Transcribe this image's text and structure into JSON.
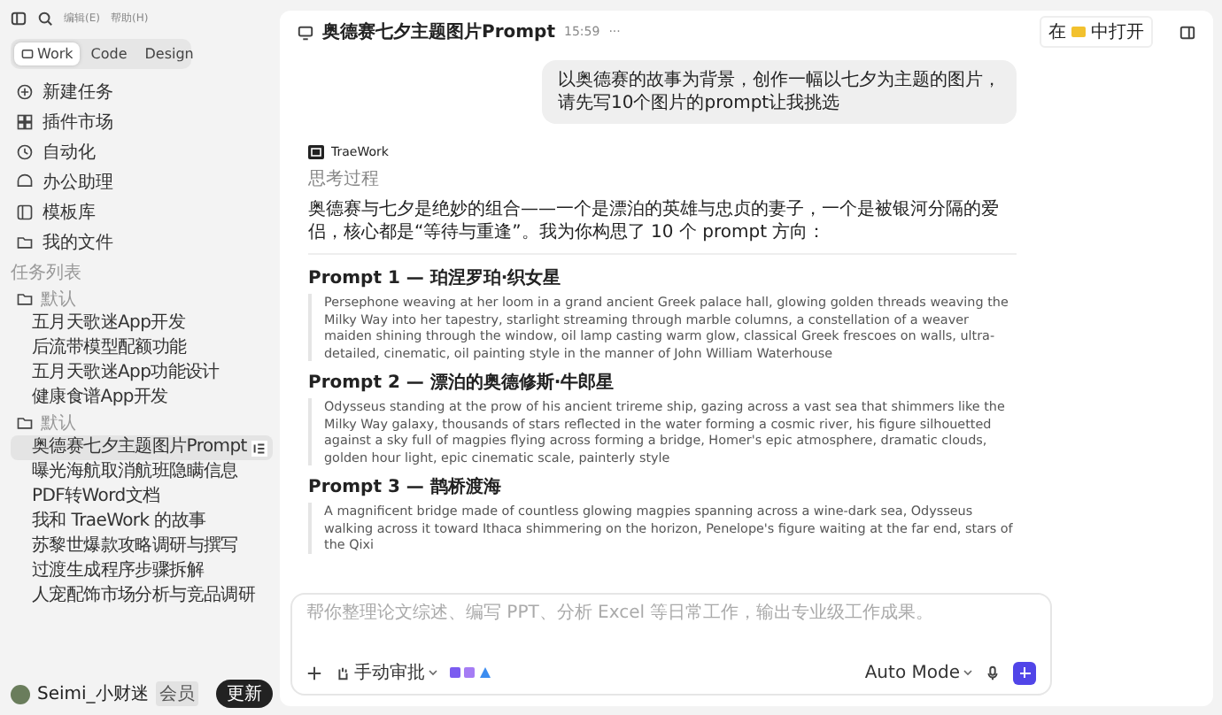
{
  "menu": [
    "编辑(E)",
    "帮助(H)"
  ],
  "mode_tabs": [
    {
      "label": "Work",
      "selected": true
    },
    {
      "label": "Code",
      "selected": false
    },
    {
      "label": "Design",
      "selected": false
    }
  ],
  "nav": [
    {
      "label": "新建任务"
    },
    {
      "label": "插件市场"
    },
    {
      "label": "自动化"
    },
    {
      "label": "办公助理"
    },
    {
      "label": "模板库"
    },
    {
      "label": "我的文件"
    }
  ],
  "task_list": {
    "title": "任务列表",
    "groups": [
      {
        "name": "默认",
        "items": [
          {
            "label": "五月天歌迷App开发",
            "selected": false
          },
          {
            "label": "后流带模型配额功能",
            "selected": false
          },
          {
            "label": "五月天歌迷App功能设计",
            "selected": false
          },
          {
            "label": "健康食谱App开发",
            "selected": false
          }
        ]
      },
      {
        "name": "默认",
        "items": [
          {
            "label": "奥德赛七夕主题图片Prompt",
            "selected": true
          },
          {
            "label": "曝光海航取消航班隐瞒信息",
            "selected": false
          },
          {
            "label": "PDF转Word文档",
            "selected": false
          },
          {
            "label": "我和 TraeWork 的故事",
            "selected": false
          },
          {
            "label": "苏黎世爆款攻略调研与撰写",
            "selected": false
          },
          {
            "label": "过渡生成程序步骤拆解",
            "selected": false
          },
          {
            "label": "人宠配饰市场分析与竞品调研",
            "selected": false
          }
        ]
      }
    ]
  },
  "user": {
    "name": "Seimi_小财迷",
    "badge": "会员",
    "update_button": "更新"
  },
  "header": {
    "title": "奥德赛七夕主题图片Prompt",
    "time": "15:59",
    "more": "···",
    "open_in": [
      "在",
      "中打开"
    ]
  },
  "user_message": "以奥德赛的故事为背景，创作一幅以七夕为主题的图片，请先写10个图片的prompt让我挑选",
  "assistant": {
    "name": "TraeWork",
    "thinking": "思考过程",
    "intro": "奥德赛与七夕是绝妙的组合——一个是漂泊的英雄与忠贞的妻子，一个是被银河分隔的爱侣，核心都是“等待与重逢”。我为你构思了 10 个 prompt 方向：",
    "prompts": [
      {
        "title": "Prompt 1 — 珀涅罗珀·织女星",
        "text": "Persephone weaving at her loom in a grand ancient Greek palace hall, glowing golden threads weaving the Milky Way into her tapestry, starlight streaming through marble columns, a constellation of a weaver maiden shining through the window, oil lamp casting warm glow, classical Greek frescoes on walls, ultra-detailed, cinematic, oil painting style in the manner of John William Waterhouse"
      },
      {
        "title": "Prompt 2 — 漂泊的奥德修斯·牛郎星",
        "text": "Odysseus standing at the prow of his ancient trireme ship, gazing across a vast sea that shimmers like the Milky Way galaxy, thousands of stars reflected in the water forming a cosmic river, his figure silhouetted against a sky full of magpies flying across forming a bridge, Homer's epic atmosphere, dramatic clouds, golden hour light, epic cinematic scale, painterly style"
      },
      {
        "title": "Prompt 3 — 鹊桥渡海",
        "text": "A magnificent bridge made of countless glowing magpies spanning across a wine-dark sea, Odysseus walking across it toward Ithaca shimmering on the horizon, Penelope's figure waiting at the far end, stars of the Qixi"
      }
    ]
  },
  "composer": {
    "placeholder": "帮你整理论文综述、编写 PPT、分析 Excel 等日常工作，输出专业级工作成果。",
    "approval": "手动审批",
    "mode": "Auto Mode"
  }
}
